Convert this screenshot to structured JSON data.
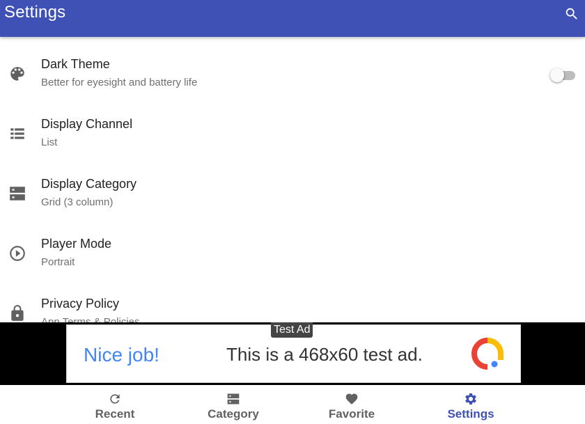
{
  "appbar": {
    "title": "Settings",
    "search_icon": "search-icon",
    "color": "#3f51b5"
  },
  "settings": [
    {
      "icon": "palette-icon",
      "title": "Dark Theme",
      "subtitle": "Better for eyesight and battery life",
      "toggle": false
    },
    {
      "icon": "list-icon",
      "title": "Display Channel",
      "subtitle": "List"
    },
    {
      "icon": "grid-icon",
      "title": "Display Category",
      "subtitle": "Grid (3 column)"
    },
    {
      "icon": "play-circle-icon",
      "title": "Player Mode",
      "subtitle": "Portrait"
    },
    {
      "icon": "lock-icon",
      "title": "Privacy Policy",
      "subtitle": "App Terms & Policies"
    }
  ],
  "ad": {
    "badge": "Test Ad",
    "headline": "Nice job!",
    "message": "This is a 468x60 test ad."
  },
  "bottom_nav": [
    {
      "icon": "refresh-icon",
      "label": "Recent",
      "active": false
    },
    {
      "icon": "category-icon",
      "label": "Category",
      "active": false
    },
    {
      "icon": "heart-icon",
      "label": "Favorite",
      "active": false
    },
    {
      "icon": "gear-icon",
      "label": "Settings",
      "active": true
    }
  ],
  "colors": {
    "primary": "#3f51b5",
    "icon_gray": "#616161",
    "text_secondary": "#6f6f6f"
  }
}
